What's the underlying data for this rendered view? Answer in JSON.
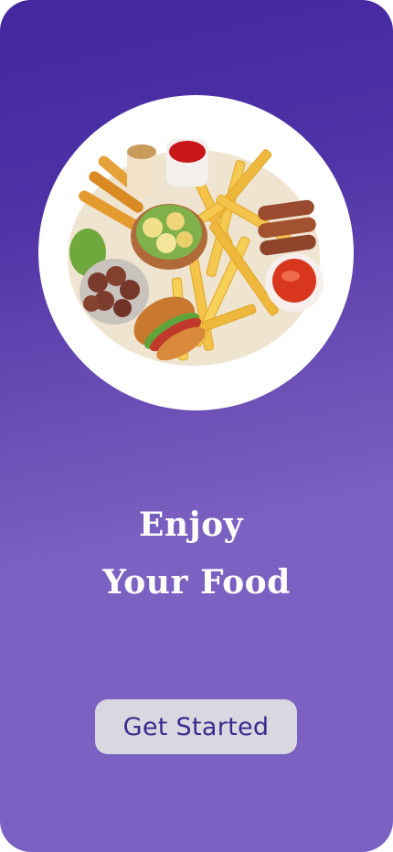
{
  "hero": {
    "image_subject": "food-platter-illustration"
  },
  "headline": {
    "line1": "Enjoy",
    "line2": "Your Food"
  },
  "cta": {
    "label": "Get Started"
  },
  "colors": {
    "background_top": "#4427a0",
    "background_bottom": "#7b62c2",
    "headline_text": "#ffffff",
    "button_bg": "#d9d7df",
    "button_text": "#3a2a8e"
  }
}
